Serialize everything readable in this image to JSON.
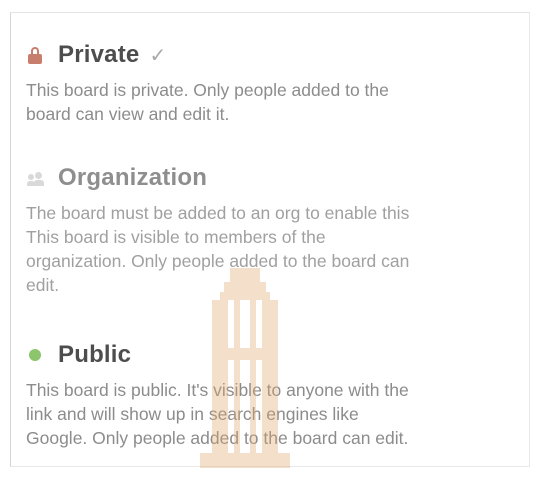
{
  "options": [
    {
      "title": "Private",
      "check": "✓",
      "description": "This board is private. Only people added to the\nboard can view and edit it.",
      "icon": "lock-icon",
      "icon_color": "#c87e6d"
    },
    {
      "title": "Organization",
      "description": "The board must be added to an org to enable this\nThis board is visible to members of the\norganization. Only people added to the board can\nedit.",
      "icon": "organization-icon",
      "icon_color": "#d9d9d9"
    },
    {
      "title": "Public",
      "description": "This board is public. It's visible to anyone with the\nlink and will show up in search engines like\nGoogle. Only people added to the board can edit.",
      "icon": "public-dot-icon",
      "icon_color": "#8cc56b"
    }
  ]
}
